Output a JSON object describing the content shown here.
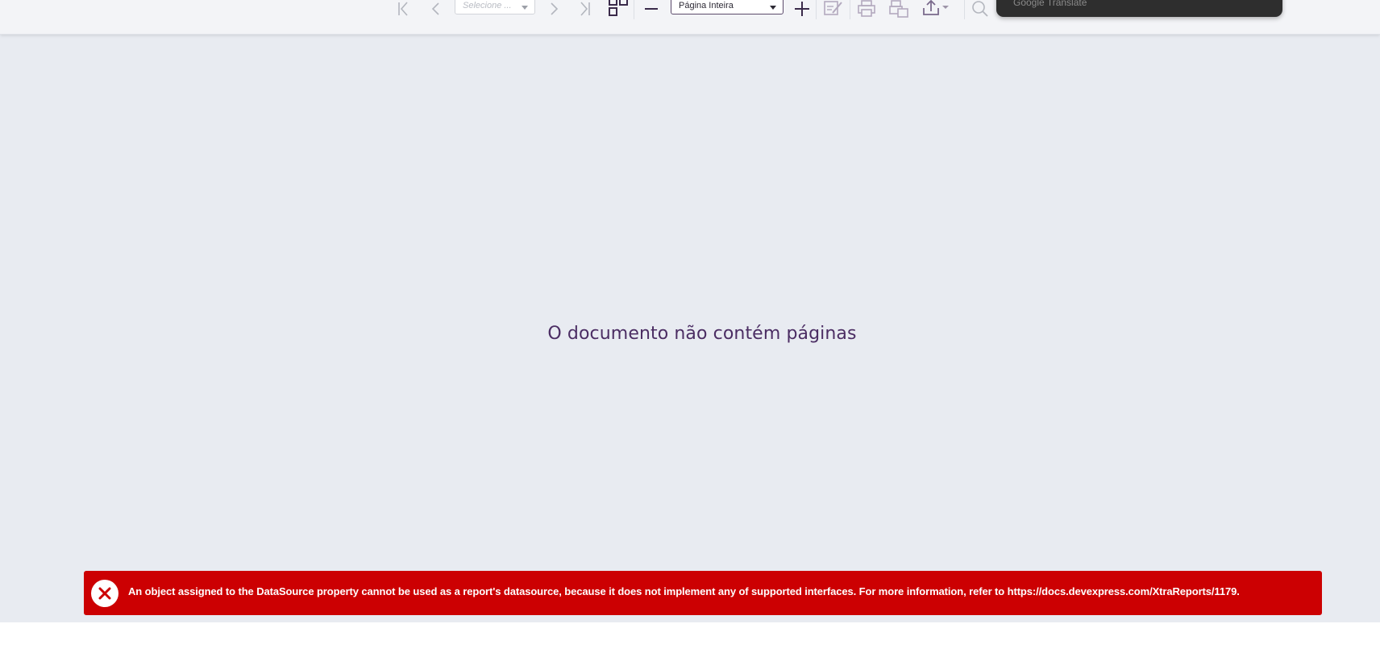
{
  "toolbar": {
    "page_select": {
      "value": "Selecione ..."
    },
    "zoom_select": {
      "value": "Página Inteira"
    },
    "icons": {
      "first_page": "first-page-icon",
      "prev_page": "chevron-left-icon",
      "next_page": "chevron-right-icon",
      "last_page": "last-page-icon",
      "multipage": "multipage-toggle-icon",
      "zoom_out": "minus-icon",
      "zoom_in": "plus-icon",
      "highlight_edit": "edit-fields-icon",
      "print": "print-icon",
      "print_page": "print-page-icon",
      "export": "export-upload-icon",
      "search": "search-icon"
    }
  },
  "translate_popup": {
    "text": "Google Translate"
  },
  "viewer": {
    "empty_message": "O documento não contém páginas"
  },
  "error": {
    "message": "An object assigned to the DataSource property cannot be used as a report's datasource, because it does not implement any of supported interfaces. For more information, refer to https://docs.devexpress.com/XtraReports/1179.",
    "color": "#cc0002"
  },
  "colors": {
    "accent": "#4b2d63",
    "toolbar_bg": "#f3f4f7",
    "viewer_bg": "#e8ebf1"
  }
}
